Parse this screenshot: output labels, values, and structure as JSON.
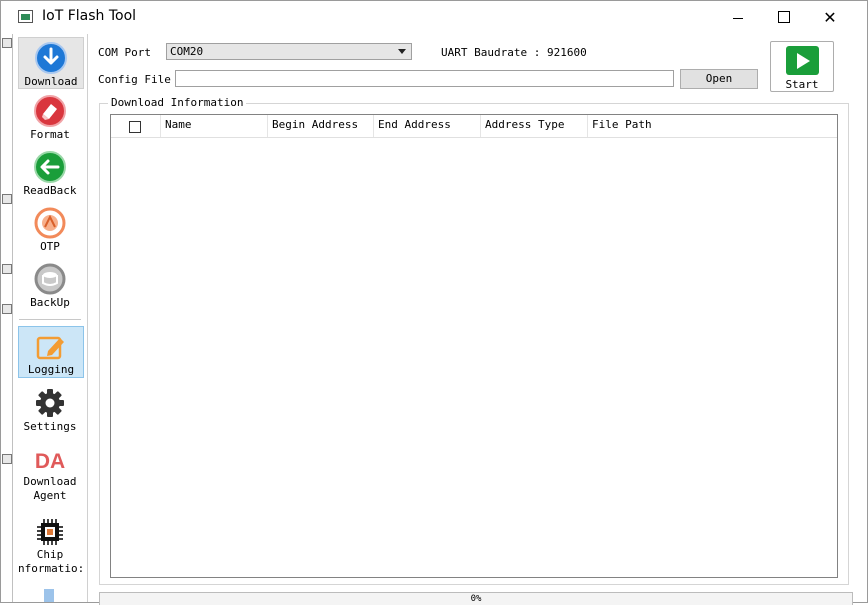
{
  "window": {
    "title": "IoT Flash Tool"
  },
  "sidebar": {
    "items": [
      {
        "label": "Download",
        "icon": "download-icon"
      },
      {
        "label": "Format",
        "icon": "format-icon"
      },
      {
        "label": "ReadBack",
        "icon": "readback-icon"
      },
      {
        "label": "OTP",
        "icon": "otp-icon"
      },
      {
        "label": "BackUp",
        "icon": "backup-icon"
      },
      {
        "label": "Logging",
        "icon": "logging-icon"
      },
      {
        "label": "Settings",
        "icon": "settings-icon"
      },
      {
        "label": "Download",
        "label2": "Agent",
        "icon_text": "DA",
        "icon": "download-agent-icon"
      },
      {
        "label": "Chip",
        "label2": "nformatio:",
        "icon": "chip-icon"
      }
    ]
  },
  "toolbar": {
    "com_port_label": "COM Port",
    "com_port_value": "COM20",
    "baudrate_text": "UART Baudrate : 921600",
    "config_file_label": "Config File",
    "config_file_value": "",
    "open_label": "Open",
    "start_label": "Start"
  },
  "download_info": {
    "title": "Download Information",
    "columns": [
      "Name",
      "Begin Address",
      "End Address",
      "Address Type",
      "File Path"
    ],
    "rows": []
  },
  "status": {
    "progress_text": "0%"
  },
  "colors": {
    "download_blue": "#1e78d6",
    "format_red": "#d9363e",
    "readback_green": "#1a9e3a",
    "otp_orange": "#f28a5a",
    "start_green": "#1a9e3a",
    "da_red": "#e05a5a",
    "logging_orange": "#f39c33"
  }
}
